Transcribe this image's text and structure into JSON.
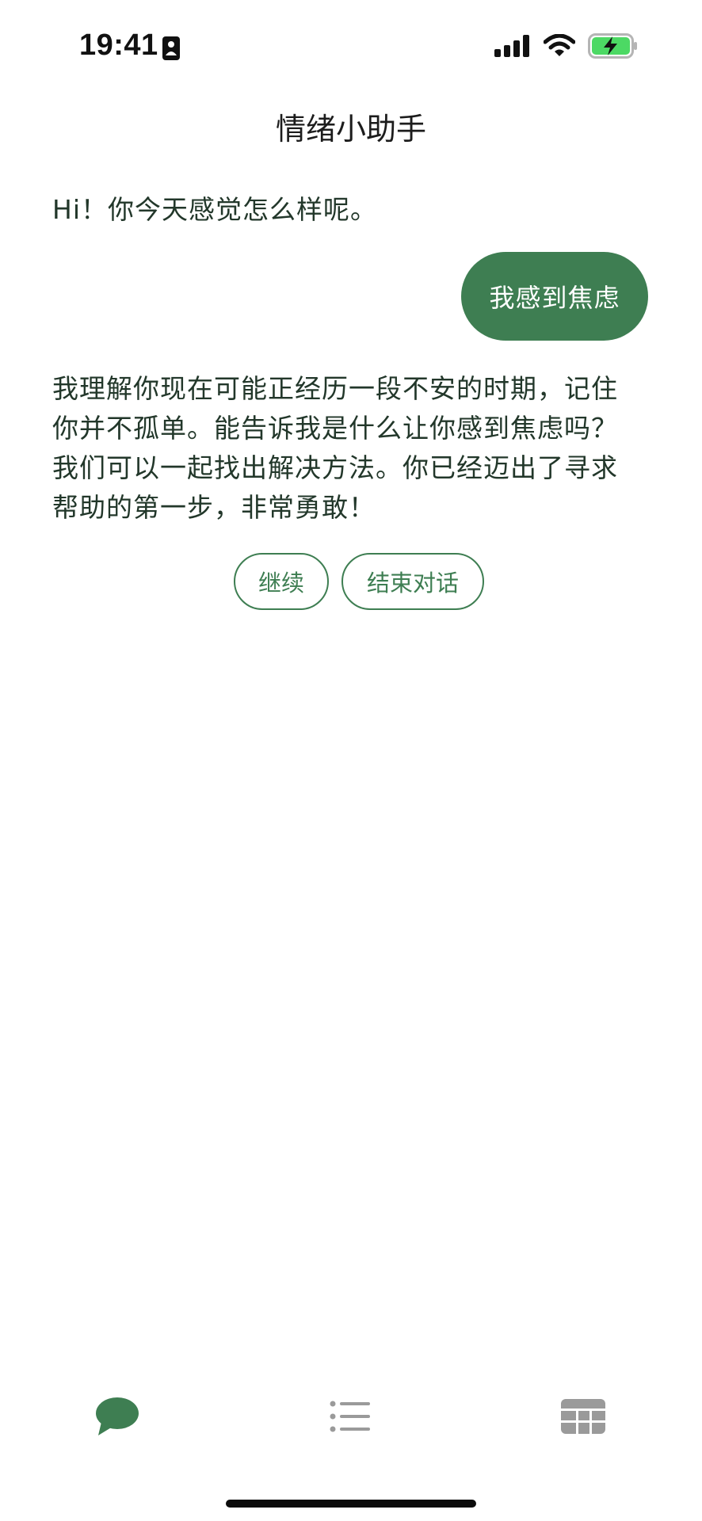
{
  "status_bar": {
    "time": "19:41",
    "icons": [
      "id-card-icon",
      "cellular-signal-icon",
      "wifi-icon",
      "battery-charging-icon"
    ]
  },
  "header": {
    "title": "情绪小助手"
  },
  "chat": {
    "messages": [
      {
        "role": "assistant",
        "text": "Hi！你今天感觉怎么样呢。"
      },
      {
        "role": "user",
        "text": "我感到焦虑"
      },
      {
        "role": "assistant",
        "text": "我理解你现在可能正经历一段不安的时期，记住你并不孤单。能告诉我是什么让你感到焦虑吗？我们可以一起找出解决方法。你已经迈出了寻求帮助的第一步，非常勇敢！"
      }
    ],
    "quick_replies": [
      "继续",
      "结束对话"
    ]
  },
  "tab_bar": {
    "tabs": [
      {
        "icon": "chat-bubble-icon",
        "active": true
      },
      {
        "icon": "list-icon",
        "active": false
      },
      {
        "icon": "grid-table-icon",
        "active": false
      }
    ]
  },
  "colors": {
    "accent": "#3e7e52",
    "inactive_icon": "#9a9a9a",
    "text": "#22372a"
  }
}
